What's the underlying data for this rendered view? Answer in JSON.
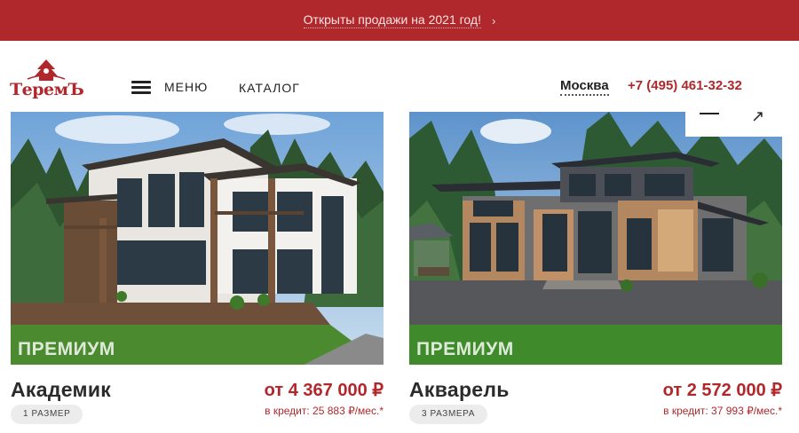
{
  "colors": {
    "brand": "#b1282c",
    "badge_bg": "#ececec"
  },
  "promo": {
    "text": "Открыты продажи на 2021 год!",
    "arrow": "›"
  },
  "header": {
    "logo_text": "ТеремЪ",
    "menu_label": "МЕНЮ",
    "catalog_label": "КАТАЛОГ",
    "city": "Москва",
    "phone": "+7 (495) 461-32-32"
  },
  "slider": {
    "prev_icon": "arrow-left-icon",
    "next_icon": "arrow-right-icon",
    "next_glyph": "↗"
  },
  "cards": [
    {
      "tier": "ПРЕМИУМ",
      "name": "Академик",
      "price": "от 4 367 000 ₽",
      "credit": "в кредит: 25 883 ₽/мес.*",
      "size_badge": "1 РАЗМЕР"
    },
    {
      "tier": "ПРЕМИУМ",
      "name": "Акварель",
      "price": "от 2 572 000 ₽",
      "credit": "в кредит: 37 993 ₽/мес.*",
      "size_badge": "3 РАЗМЕРА"
    }
  ]
}
